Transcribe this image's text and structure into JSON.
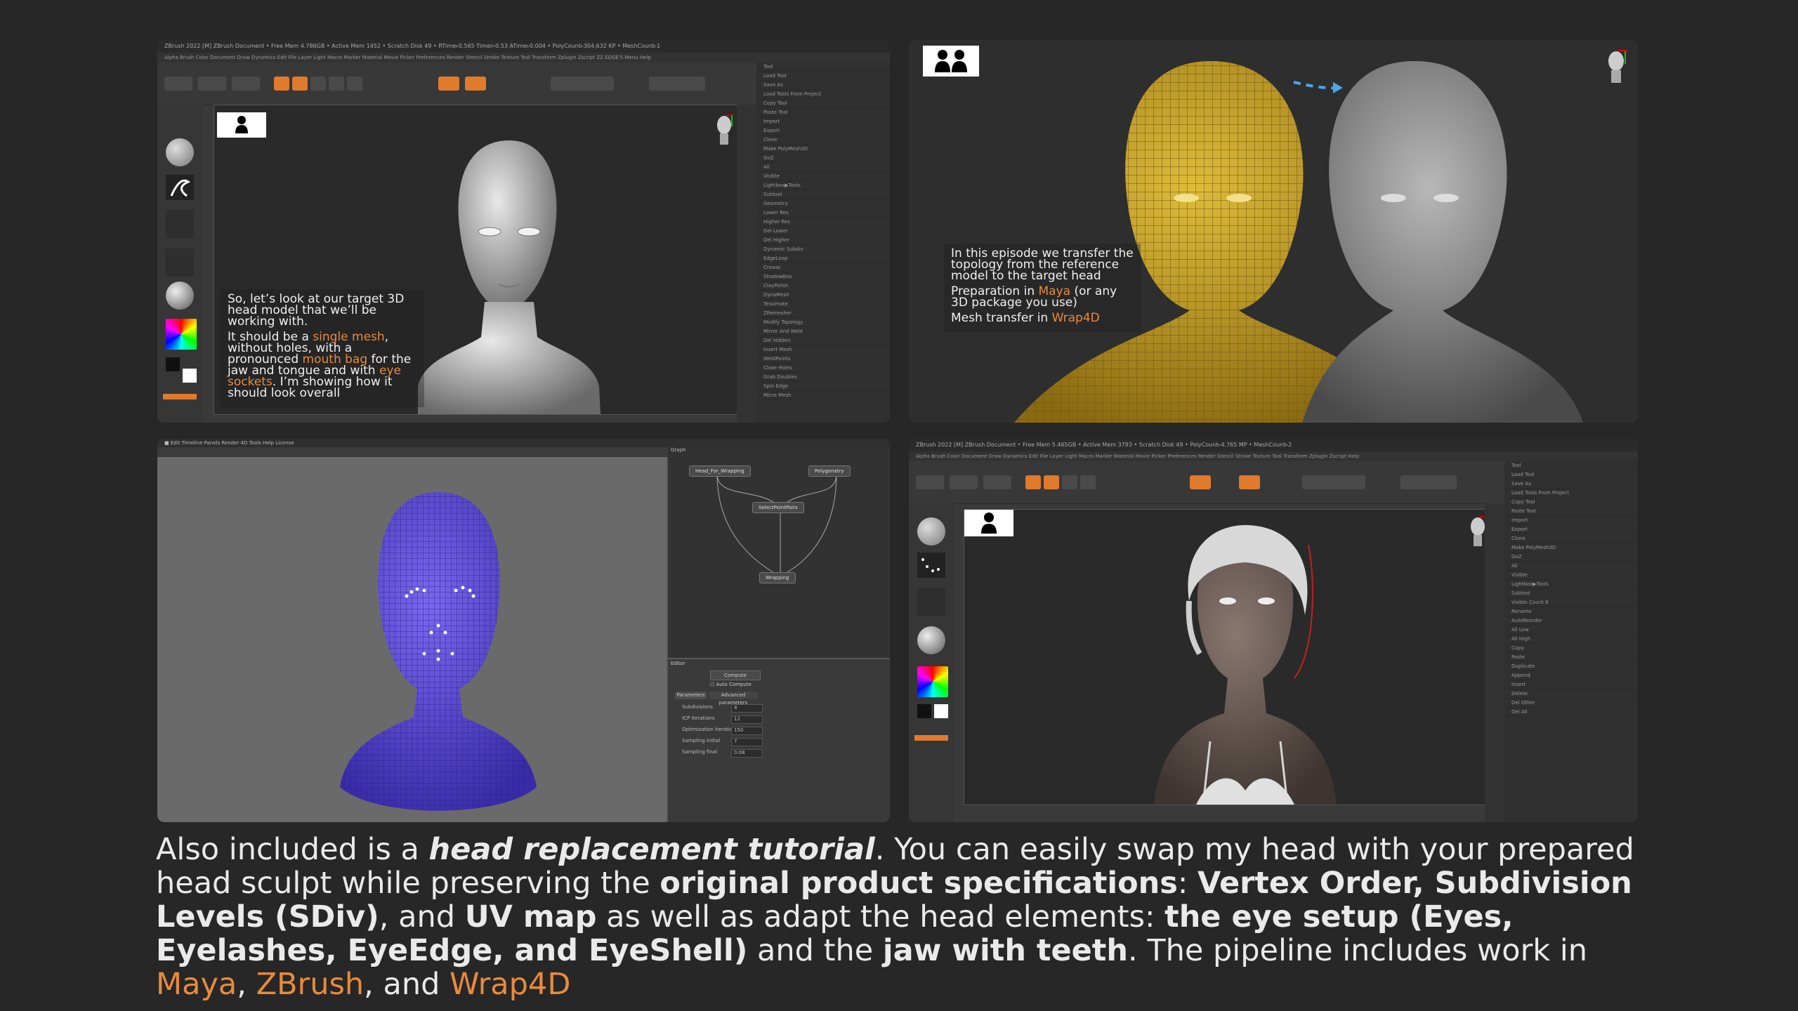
{
  "panel1": {
    "title_bar": "ZBrush 2022 [M]   ZBrush Document   • Free Mem 4.786GB • Active Mem 1452 • Scratch Disk 49 • RTime▹0.565 Timer▹0.53 ATime▹0.004 • PolyCount▹304,632 KP • MeshCount▹1",
    "menu_bar": "Alpha  Brush  Color  Document  Draw  Dynamics  Edit  File  Layer  Light  Macro  Marker  Material  Movie  Picker  Preferences  Render  Stencil  Stroke  Texture  Tool  Transform  Zplugin  Zscript  ZZ EDGE'S Menu  Help",
    "tool_panel": [
      "Tool",
      "Load Tool",
      "Save As",
      "Load Tools From Project",
      "Copy Tool",
      "Paste Tool",
      "Import",
      "Export",
      "Clone",
      "Make PolyMesh3D",
      "GoZ",
      "All",
      "Visible",
      "Lightbox▶Tools",
      "Subtool",
      "Geometry",
      "Lower Res",
      "Higher Res",
      "Del Lower",
      "Del Higher",
      "Dynamic Subdiv",
      "EdgeLoop",
      "Crease",
      "ShadowBox",
      "ClayPolish",
      "DynaMesh",
      "Tessimate",
      "ZRemesher",
      "Modify Topology",
      "Mirror And Weld",
      "Del Hidden",
      "Insert Mesh",
      "WeldPoints",
      "Close Holes",
      "Grab Doubles",
      "Spin Edge",
      "Micro Mesh"
    ],
    "caption": {
      "line1": "So, let’s look at our target 3D head model that we’ll be working with.",
      "line2_a": "It should be a ",
      "line2_b": "single mesh",
      "line2_c": ", without holes, with a pronounced ",
      "line2_d": "mouth bag",
      "line2_e": " for the jaw and tongue and with ",
      "line2_f": "eye sockets",
      "line2_g": ". I’m showing how it should look overall"
    }
  },
  "panel2": {
    "caption": {
      "intro": "In this episode we transfer the topology from the reference model to the target head",
      "prep_a": "Preparation in ",
      "prep_b": "Maya",
      "prep_c": " (or any 3D package you use)",
      "mesh_a": "Mesh transfer in ",
      "mesh_b": "Wrap4D"
    }
  },
  "panel3": {
    "menu_bar": "■  Edit  Timeline  Panels  Render  4D Tools  Help  License",
    "graph_title": "Graph",
    "nodes": [
      "Head_For_Wrapping",
      "Polygonatry",
      "SelectPointPairs",
      "Wrapping"
    ],
    "editor_title": "Editor",
    "compute": "Compute",
    "auto_compute": "Auto Compute",
    "tabs": [
      "Parameters",
      "Advanced parameters"
    ],
    "fields": [
      {
        "label": "Subdivisions",
        "value": "4"
      },
      {
        "label": "ICP iterations",
        "value": "12"
      },
      {
        "label": "Optimization iterations",
        "value": "150"
      },
      {
        "label": "Sampling initial",
        "value": "7"
      },
      {
        "label": "Sampling final",
        "value": "0.08"
      }
    ]
  },
  "panel4": {
    "title_bar": "ZBrush 2022 [M]   ZBrush Document   • Free Mem 5.465GB • Active Mem 3793 • Scratch Disk 49 • PolyCount▹4.765 MP • MeshCount▹2",
    "menu_bar": "Alpha  Brush  Color  Document  Draw  Dynamics  Edit  File  Layer  Light  Macro  Marker  Material  Movie  Picker  Preferences  Render  Stencil  Stroke  Texture  Tool  Transform  Zplugin  Zscript  Help",
    "tool_panel": [
      "Tool",
      "Load Tool",
      "Save As",
      "Load Tools From Project",
      "Copy Tool",
      "Paste Tool",
      "Import",
      "Export",
      "Clone",
      "Make PolyMesh3D",
      "GoZ",
      "All",
      "Visible",
      "Lightbox▶Tools",
      "Subtool",
      "Visible Count 8",
      "Rename",
      "AutoReorder",
      "All Low",
      "All High",
      "Copy",
      "Paste",
      "Duplicate",
      "Append",
      "Insert",
      "Delete",
      "Del Other",
      "Del All"
    ]
  },
  "body": {
    "p1": "Also included is a ",
    "p2": "head replacement tutorial",
    "p3": ". You can easily swap my head with your prepared head sculpt while preserving the ",
    "p4": "original product specifications",
    "p5": ": ",
    "p6": "Vertex Order, Subdivision Levels (SDiv)",
    "p7": ", and ",
    "p8": "UV map",
    "p9": " as well as adapt the head elements: ",
    "p10": "the eye setup (Eyes, Eyelashes, EyeEdge, and EyeShell)",
    "p11": " and the ",
    "p12": "jaw with teeth",
    "p13": ". The pipeline includes work in ",
    "p14": "Maya",
    "p15": ", ",
    "p16": "ZBrush",
    "p17": ", and ",
    "p18": "Wrap4D"
  },
  "colors": {
    "accent": "#e88b3c",
    "background": "#272727",
    "wrap_mesh": "#5b4ad6",
    "ref_mesh": "#c9a52a"
  }
}
